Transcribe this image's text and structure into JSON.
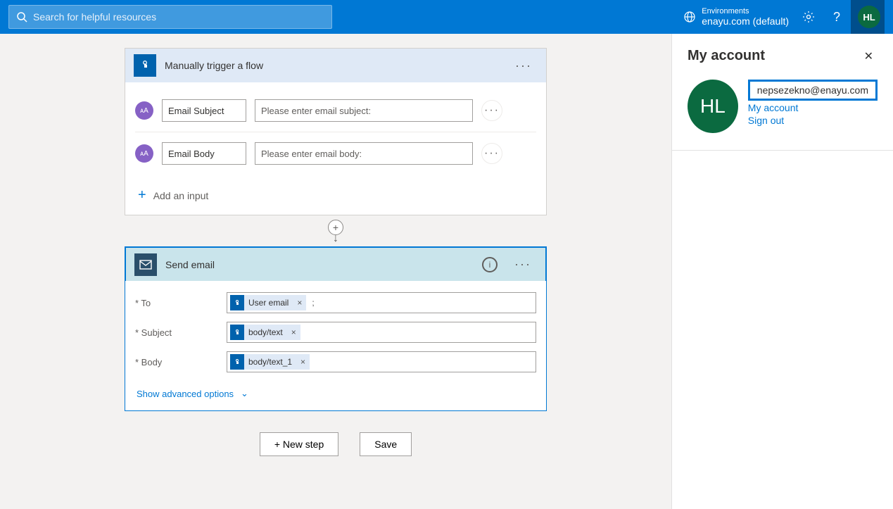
{
  "header": {
    "search_placeholder": "Search for helpful resources",
    "env_label": "Environments",
    "env_value": "enayu.com (default)",
    "avatar_initials": "HL"
  },
  "flow": {
    "trigger": {
      "title": "Manually trigger a flow",
      "inputs": [
        {
          "label": "Email Subject",
          "placeholder": "Please enter email subject:"
        },
        {
          "label": "Email Body",
          "placeholder": "Please enter email body:"
        }
      ],
      "add_input_label": "Add an input"
    },
    "action": {
      "title": "Send email",
      "fields": {
        "to_label": "* To",
        "to_token": "User email",
        "subject_label": "* Subject",
        "subject_token": "body/text",
        "body_label": "* Body",
        "body_token": "body/text_1"
      },
      "advanced": "Show advanced options"
    },
    "buttons": {
      "new_step": "+ New step",
      "save": "Save"
    }
  },
  "panel": {
    "title": "My account",
    "avatar_initials": "HL",
    "email": "nepsezekno@enayu.com",
    "link_account": "My account",
    "link_signout": "Sign out"
  }
}
